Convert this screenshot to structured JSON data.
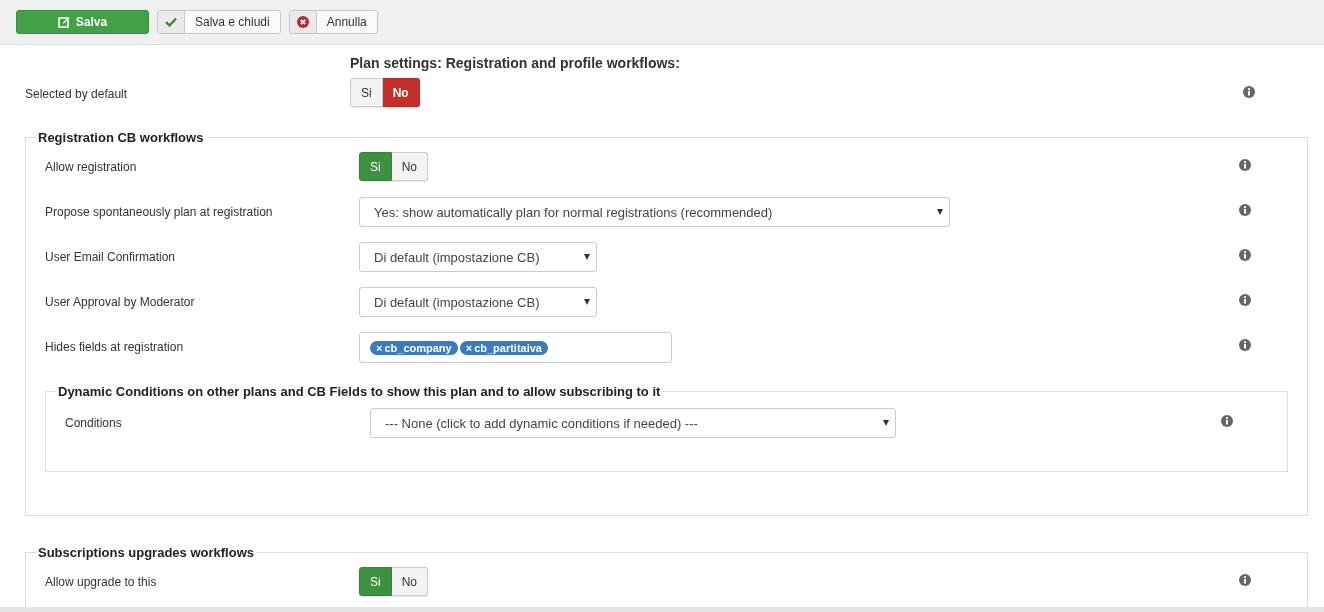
{
  "toolbar": {
    "buttons": [
      {
        "label": "Salva",
        "kind": "primary"
      },
      {
        "label": "Salva e chiudi",
        "kind": "check"
      },
      {
        "label": "Annulla",
        "kind": "cancel"
      }
    ]
  },
  "heading": "Plan settings: Registration and profile workflows:",
  "top_rows": [
    {
      "label": "Selected by default",
      "kind": "toggle",
      "options": [
        {
          "label": "Si",
          "selected": false
        },
        {
          "label": "No",
          "selected": true
        }
      ]
    }
  ],
  "sections": [
    {
      "legend": "Registration CB workflows",
      "rows": [
        {
          "label": "Allow registration",
          "kind": "toggle",
          "options": [
            {
              "label": "Si",
              "selected": true
            },
            {
              "label": "No",
              "selected": false
            }
          ]
        },
        {
          "label": "Propose spontaneously plan at registration",
          "kind": "select",
          "wide": true,
          "value": "Yes: show automatically plan for normal registrations (recommended)"
        },
        {
          "label": "User Email Confirmation",
          "kind": "select",
          "wide": false,
          "value": "Di default (impostazione CB)"
        },
        {
          "label": "User Approval by Moderator",
          "kind": "select",
          "wide": false,
          "value": "Di default (impostazione CB)"
        },
        {
          "label": "Hides fields at registration",
          "kind": "tags",
          "tags": [
            {
              "remove": "×",
              "label": "cb_company"
            },
            {
              "remove": "×",
              "label": "cb_partitaiva"
            }
          ]
        }
      ],
      "subsections": [
        {
          "legend": "Dynamic Conditions on other plans and CB Fields to show this plan and to allow subscribing to it",
          "rows": [
            {
              "label": "Conditions",
              "kind": "select",
              "wide": true,
              "value": "--- None (click to add dynamic conditions if needed) ---"
            }
          ]
        }
      ]
    },
    {
      "legend": "Subscriptions upgrades workflows",
      "rows": [
        {
          "label": "Allow upgrade to this",
          "kind": "toggle",
          "options": [
            {
              "label": "Si",
              "selected": true
            },
            {
              "label": "No",
              "selected": false
            }
          ]
        }
      ]
    }
  ]
}
